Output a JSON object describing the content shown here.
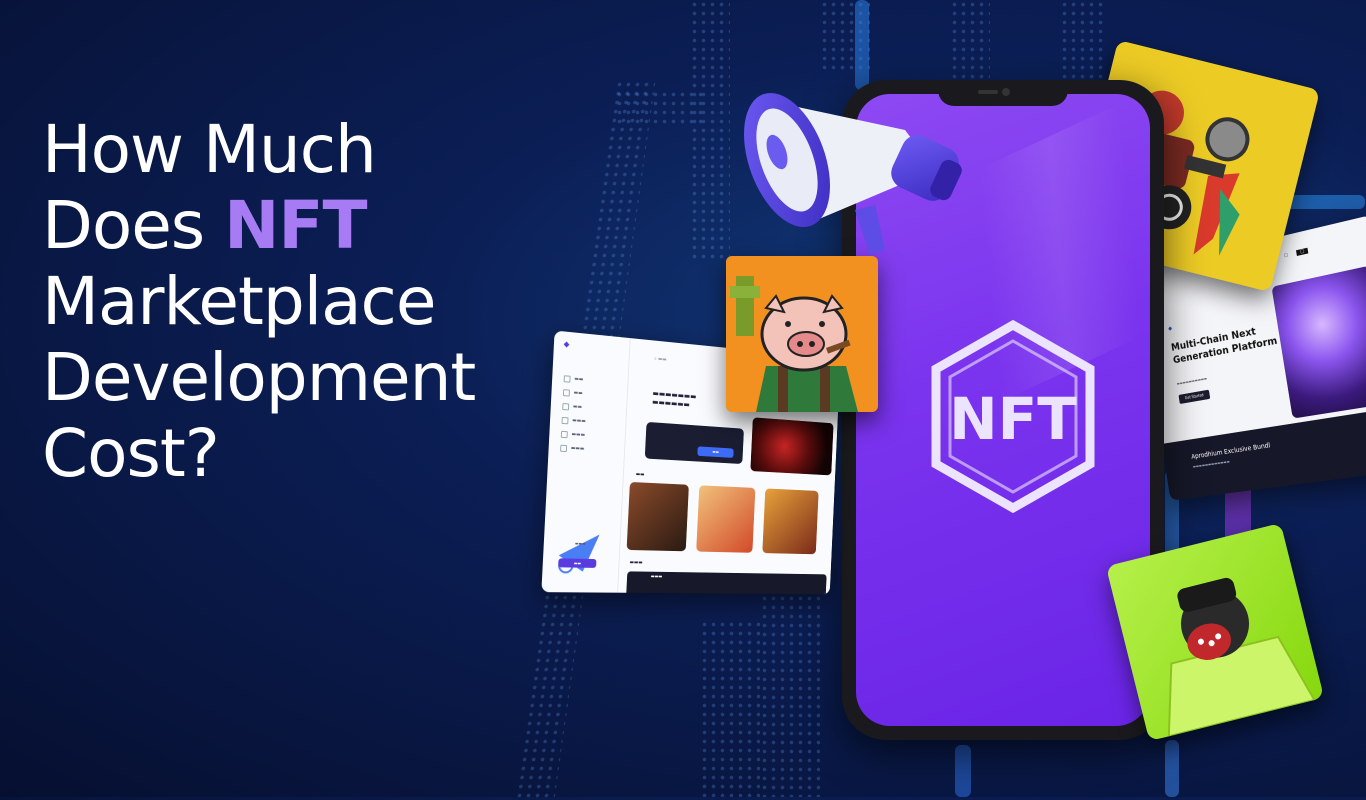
{
  "headline": {
    "line1": "How Much",
    "line2_prefix": "Does ",
    "line2_accent": "NFT",
    "line3": "Marketplace",
    "line4": "Development",
    "line5": "Cost?"
  },
  "colors": {
    "accent": "#a77bf4",
    "phone_screen": "#7a33ee",
    "background": "#0b1e55"
  },
  "phone": {
    "logo_text": "NFT"
  },
  "website_card": {
    "title": "Multi-Chain Next Generation Platform",
    "cta": "Get Started",
    "collection": "Aprodhium Exclusive Bundl"
  },
  "icons": [
    "megaphone-icon",
    "nft-hexagon-icon"
  ]
}
